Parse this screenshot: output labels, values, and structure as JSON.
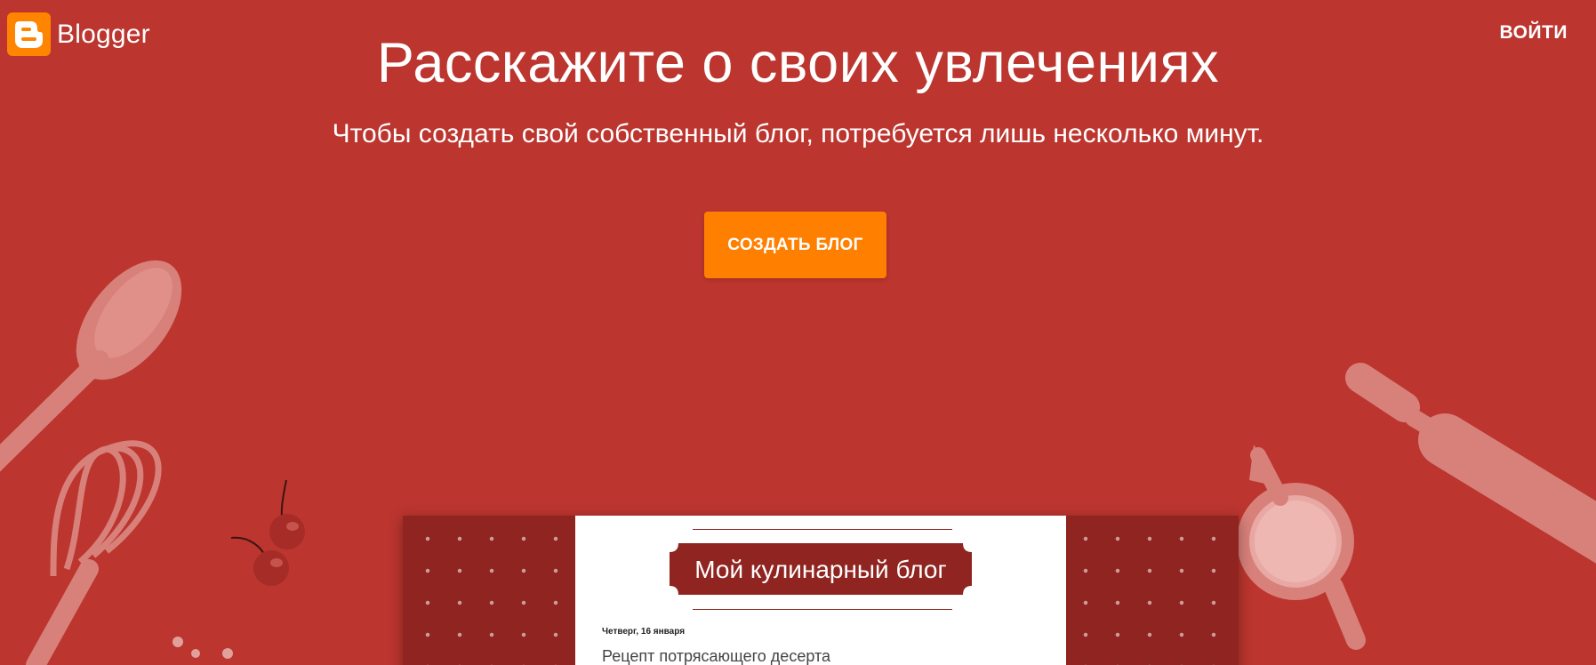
{
  "brand": {
    "name": "Blogger"
  },
  "header": {
    "signin_label": "ВОЙТИ"
  },
  "hero": {
    "title": "Расскажите о своих увлечениях",
    "subtitle": "Чтобы создать свой собственный блог, потребуется лишь несколько минут.",
    "cta_label": "СОЗДАТЬ БЛОГ"
  },
  "preview": {
    "blog_title": "Мой кулинарный блог",
    "post_date": "Четверг, 16 января",
    "post_title": "Рецепт потрясающего десерта"
  },
  "colors": {
    "background": "#bc352f",
    "accent": "#ff7f00",
    "logo": "#ff8400",
    "preview_dark": "#8f2420",
    "illustration": "#d8807a"
  },
  "icons": {
    "logo": "blogger-logo-icon"
  }
}
